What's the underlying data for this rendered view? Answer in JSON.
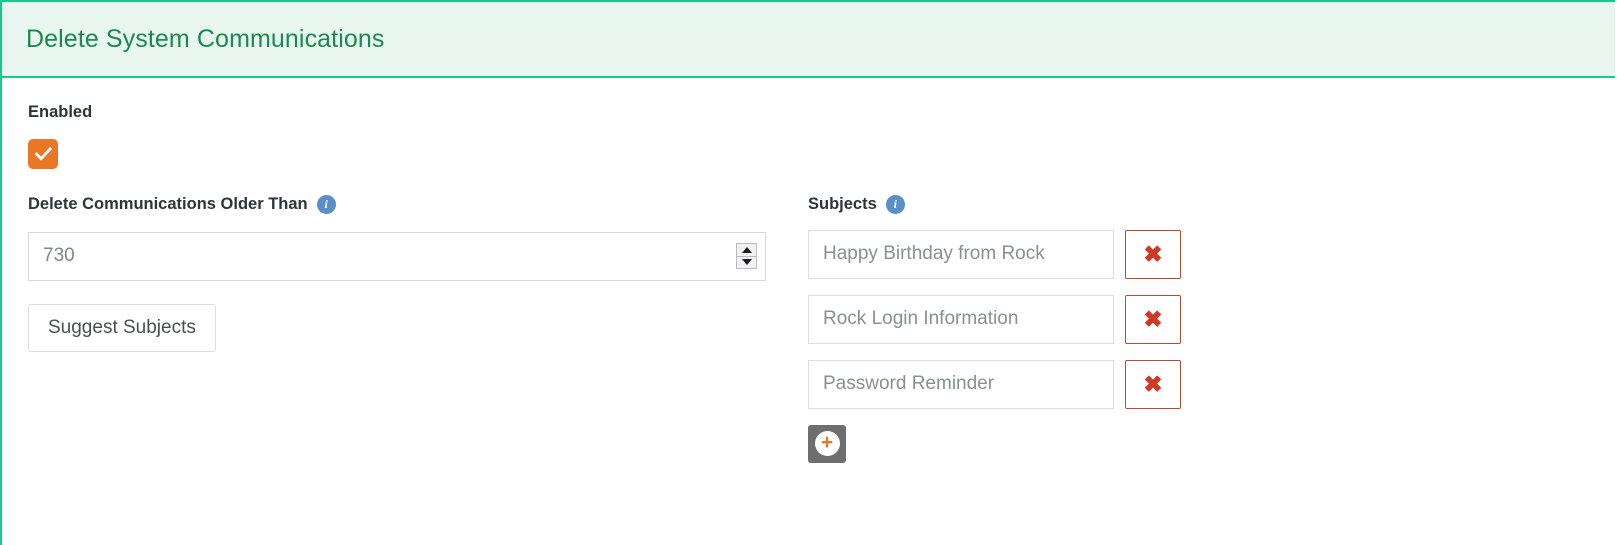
{
  "panel": {
    "title": "Delete System Communications",
    "accent_color": "#16c98d",
    "header_bg": "#e9f5ef",
    "title_color": "#1b8a4e"
  },
  "enabled": {
    "label": "Enabled",
    "checked": true,
    "checkbox_color": "#ea7725",
    "check_glyph": "check-mark"
  },
  "older_than": {
    "label": "Delete Communications Older Than",
    "info_icon": "info-circle-icon",
    "value": "730",
    "placeholder": "",
    "spinner_up_icon": "triangle-up-icon",
    "spinner_down_icon": "triangle-down-icon"
  },
  "suggest": {
    "label": "Suggest Subjects"
  },
  "subjects": {
    "label": "Subjects",
    "info_icon": "info-circle-icon",
    "delete_icon": "times-icon",
    "delete_glyph": "✖",
    "delete_border_color": "#b94a32",
    "delete_icon_color": "#cf3a26",
    "add_icon": "plus-circle-icon",
    "add_glyph": "+",
    "add_bg_color": "#6e6e6e",
    "add_plus_color": "#ea7725",
    "items": [
      {
        "value": "Happy Birthday from Rock"
      },
      {
        "value": "Rock Login Information"
      },
      {
        "value": "Password Reminder"
      }
    ]
  }
}
